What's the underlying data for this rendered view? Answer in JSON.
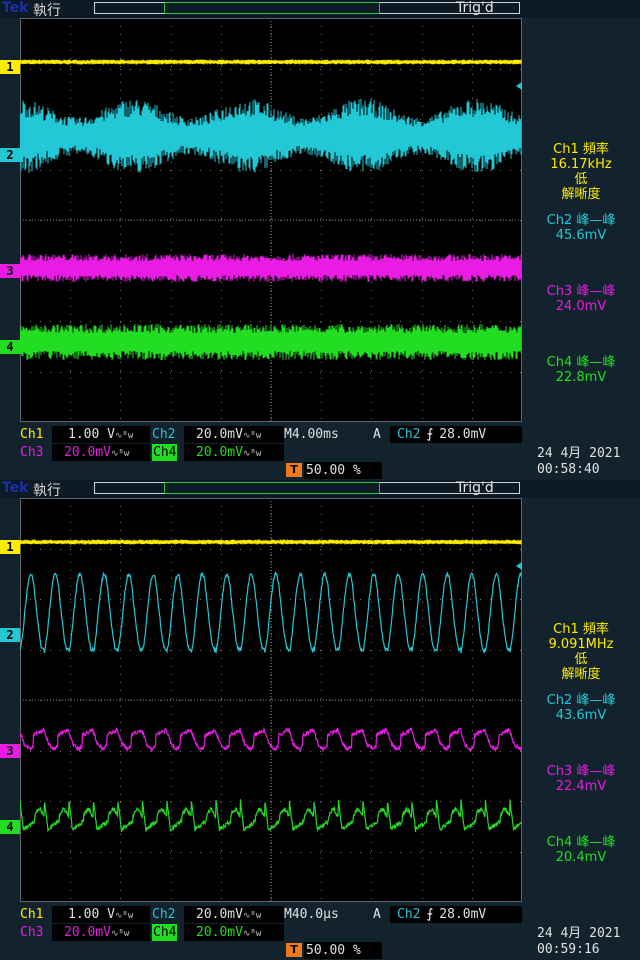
{
  "colors": {
    "ch1": "#ffeb00",
    "ch2": "#23c8d6",
    "ch3": "#e81ce3",
    "ch4": "#22dd22",
    "orange": "#f07a1c",
    "label": "#c8c8c8"
  },
  "icons": [
    "trigger-T-icon",
    "coupling-icon",
    "rising-edge-icon",
    "channel-marker-icon"
  ],
  "panels": [
    {
      "run": "執行",
      "trig": "Trig'd",
      "tek": "Tek",
      "ch_labels": [
        "1",
        "2",
        "3",
        "4"
      ],
      "meas": {
        "ch1_name": "Ch1 頻率",
        "ch1_val": "16.17kHz",
        "ch1_low": "低",
        "ch1_res": "解晰度",
        "ch2_name": "Ch2 峰—峰",
        "ch2_val": "45.6mV",
        "ch3_name": "Ch3 峰—峰",
        "ch3_val": "24.0mV",
        "ch4_name": "Ch4 峰—峰",
        "ch4_val": "22.8mV"
      },
      "bottom": {
        "ch1": "Ch1",
        "ch1_scale": "1.00 V",
        "ch2": "Ch2",
        "ch2_scale": "20.0mV",
        "ch3": "Ch3",
        "ch3_scale": "20.0mV",
        "ch4": "Ch4",
        "ch4_scale": "20.0mV",
        "timebase": "M4.00ms",
        "a": "A",
        "trig_src": "Ch2",
        "trig_level": "28.0mV",
        "trig_pos": "50.00 %"
      },
      "date": "24 4月  2021",
      "time": "00:58:40",
      "mode": "noisy"
    },
    {
      "run": "執行",
      "trig": "Trig'd",
      "tek": "Tek",
      "ch_labels": [
        "1",
        "2",
        "3",
        "4"
      ],
      "meas": {
        "ch1_name": "Ch1 頻率",
        "ch1_val": "9.091MHz",
        "ch1_low": "低",
        "ch1_res": "解晰度",
        "ch2_name": "Ch2 峰—峰",
        "ch2_val": "43.6mV",
        "ch3_name": "Ch3 峰—峰",
        "ch3_val": "22.4mV",
        "ch4_name": "Ch4 峰—峰",
        "ch4_val": "20.4mV"
      },
      "bottom": {
        "ch1": "Ch1",
        "ch1_scale": "1.00 V",
        "ch2": "Ch2",
        "ch2_scale": "20.0mV",
        "ch3": "Ch3",
        "ch3_scale": "20.0mV",
        "ch4": "Ch4",
        "ch4_scale": "20.0mV",
        "timebase": "M40.0µs",
        "a": "A",
        "trig_src": "Ch2",
        "trig_level": "28.0mV",
        "trig_pos": "50.00 %"
      },
      "date": "24 4月  2021",
      "time": "00:59:16",
      "mode": "periodic"
    }
  ]
}
